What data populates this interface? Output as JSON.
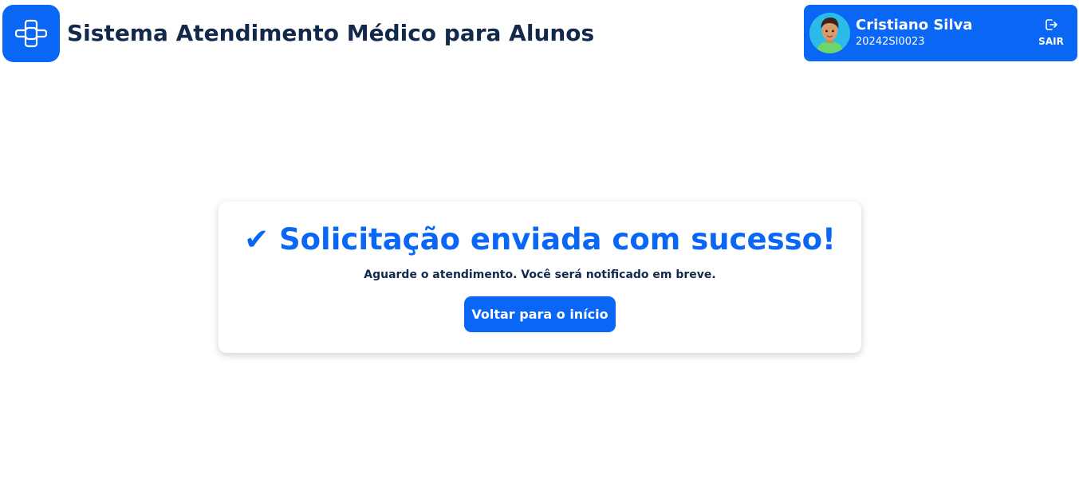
{
  "header": {
    "title": "Sistema Atendimento Médico para Alunos",
    "logo_icon": "medical-cross-icon"
  },
  "user": {
    "name": "Cristiano Silva",
    "id": "20242SI0023",
    "avatar_icon": "user-avatar",
    "logout_label": "SAIR",
    "logout_icon": "logout-icon"
  },
  "confirmation": {
    "title": "✔ Solicitação enviada com sucesso!",
    "message": "Aguarde o atendimento. Você será notificado em breve.",
    "button_label": "Voltar para o início"
  },
  "colors": {
    "primary": "#0a66f5",
    "text_dark": "#13294b",
    "background": "#ffffff"
  }
}
